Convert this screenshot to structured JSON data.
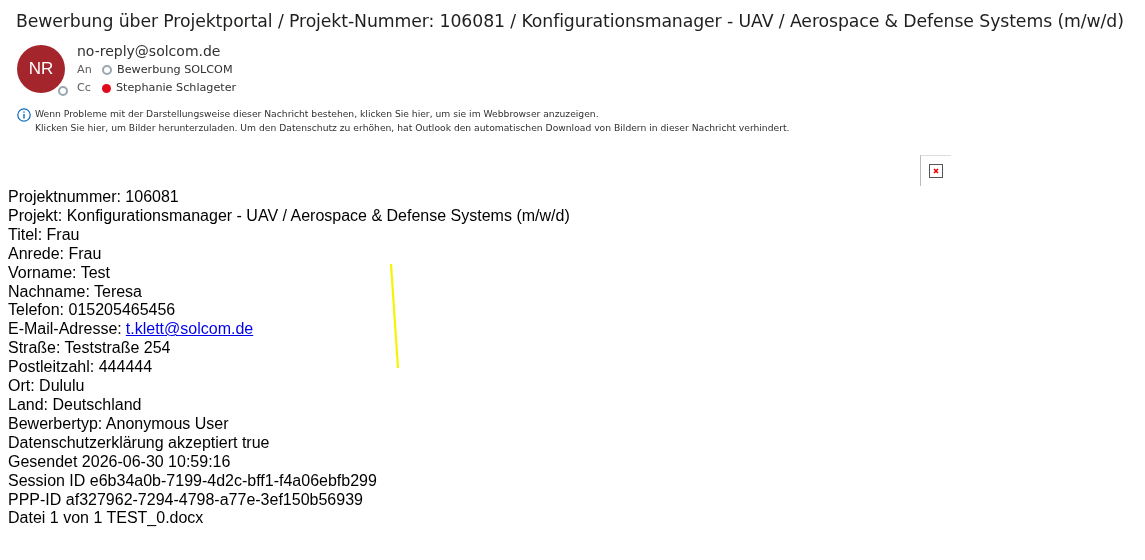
{
  "subject": "Bewerbung über Projektportal / Projekt-Nummer: 106081 / Konfigurationsmanager - UAV / Aerospace & Defense Systems (m/w/d)",
  "sender": {
    "initials": "NR",
    "address": "no-reply@solcom.de",
    "presence": {
      "kind": "ring",
      "color": "#9aa6b0"
    }
  },
  "recipients": [
    {
      "field": "An",
      "name": "Bewerbung SOLCOM",
      "presence": {
        "kind": "ring",
        "color": "#9aa6b0"
      }
    },
    {
      "field": "Cc",
      "name": "Stephanie Schlageter",
      "presence": {
        "kind": "dot",
        "color": "#e00b1c"
      }
    }
  ],
  "infobar": [
    "Wenn Probleme mit der Darstellungsweise dieser Nachricht bestehen, klicken Sie hier, um sie im Webbrowser anzuzeigen.",
    "Klicken Sie hier, um Bilder herunterzuladen. Um den Datenschutz zu erhöhen, hat Outlook den automatischen Download von Bildern in dieser Nachricht verhindert."
  ],
  "body_lines": [
    {
      "text": "Projektnummer: 106081"
    },
    {
      "text": "Projekt: Konfigurationsmanager - UAV / Aerospace & Defense Systems (m/w/d)"
    },
    {
      "text": "Titel: Frau"
    },
    {
      "text": "Anrede: Frau"
    },
    {
      "text": "Vorname: Test"
    },
    {
      "text": "Nachname: Teresa"
    },
    {
      "text": "Telefon: 015205465456"
    },
    {
      "text": "E-Mail-Adresse:",
      "link": "t.klett@solcom.de"
    },
    {
      "text": "Straße: Teststraße 254"
    },
    {
      "text": "Postleitzahl: 444444"
    },
    {
      "text": "Ort: Dululu"
    },
    {
      "text": "Land: Deutschland"
    },
    {
      "text": "Bewerbertyp: Anonymous User"
    },
    {
      "text": "Datenschutzerklärung akzeptiert true"
    },
    {
      "text": "Gesendet 2026-06-30 10:59:16"
    },
    {
      "text": "Session ID e6b34a0b-7199-4d2c-bff1-f4a06ebfb299"
    },
    {
      "text": "PPP-ID af327962-7294-4798-a77e-3ef150b56939"
    },
    {
      "text": "Datei 1 von 1 TEST_0.docx"
    }
  ]
}
